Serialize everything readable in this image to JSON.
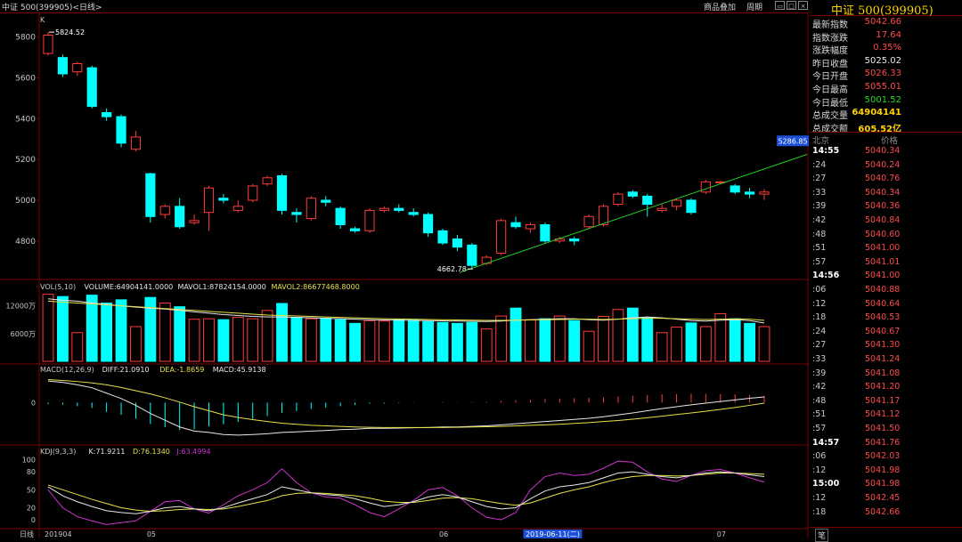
{
  "header": {
    "title": "中证 500(399905)<日线>",
    "btn_overlay": "商品叠加",
    "btn_period": "周期"
  },
  "quote": {
    "name": "中证  500(399905)",
    "rows": [
      {
        "label": "最新指数",
        "value": "5042.66",
        "color": "#ff4a4a"
      },
      {
        "label": "指数涨跌",
        "value": "17.64",
        "color": "#ff4a4a"
      },
      {
        "label": "涨跌幅度",
        "value": "0.35%",
        "color": "#ff4a4a"
      },
      {
        "label": "昨日收盘",
        "value": "5025.02",
        "color": "#e8e8e8"
      },
      {
        "label": "今日开盘",
        "value": "5026.33",
        "color": "#ff4a4a"
      },
      {
        "label": "今日最高",
        "value": "5055.01",
        "color": "#ff4a4a"
      },
      {
        "label": "今日最低",
        "value": "5001.52",
        "color": "#22dd22"
      },
      {
        "label": "总成交量",
        "value": "64904141",
        "color": "#ffd400"
      },
      {
        "label": "总成交额",
        "value": "605.52亿",
        "color": "#ffd400"
      }
    ],
    "tick_header": {
      "left": "北京",
      "right": "价格"
    },
    "ticks": [
      {
        "time": "14:55",
        "price": "5040.34",
        "bold": true
      },
      {
        "time": ":24",
        "price": "5040.24"
      },
      {
        "time": ":27",
        "price": "5040.76"
      },
      {
        "time": ":33",
        "price": "5040.34"
      },
      {
        "time": ":39",
        "price": "5040.36"
      },
      {
        "time": ":42",
        "price": "5040.84"
      },
      {
        "time": ":48",
        "price": "5040.60"
      },
      {
        "time": ":51",
        "price": "5041.00"
      },
      {
        "time": ":57",
        "price": "5041.01"
      },
      {
        "time": "14:56",
        "price": "5041.00",
        "bold": true
      },
      {
        "time": ":06",
        "price": "5040.88"
      },
      {
        "time": ":12",
        "price": "5040.64"
      },
      {
        "time": ":18",
        "price": "5040.53"
      },
      {
        "time": ":24",
        "price": "5040.67"
      },
      {
        "time": ":27",
        "price": "5041.30"
      },
      {
        "time": ":33",
        "price": "5041.24"
      },
      {
        "time": ":39",
        "price": "5041.08"
      },
      {
        "time": ":42",
        "price": "5041.20"
      },
      {
        "time": ":48",
        "price": "5041.17"
      },
      {
        "time": ":51",
        "price": "5041.12"
      },
      {
        "time": ":57",
        "price": "5041.50"
      },
      {
        "time": "14:57",
        "price": "5041.76",
        "bold": true
      },
      {
        "time": ":06",
        "price": "5042.03"
      },
      {
        "time": ":12",
        "price": "5041.98"
      },
      {
        "time": "15:00",
        "price": "5041.98",
        "bold": true
      },
      {
        "time": ":12",
        "price": "5042.45"
      },
      {
        "time": ":18",
        "price": "5042.66"
      }
    ],
    "tab_label": "笔"
  },
  "colors": {
    "up": "#ff3b3b",
    "down": "#00ffff",
    "grid": "#7a0000",
    "ma1": "#e8e8e8",
    "ma2": "#e8e04a",
    "macd_dea": "#e8e04a",
    "kdj_j": "#cc33cc"
  },
  "chart_data": [
    {
      "type": "candlestick",
      "title": "K",
      "ylim": [
        4620,
        5860
      ],
      "yticks": [
        4800,
        5000,
        5200,
        5400,
        5600,
        5800
      ],
      "current_price_label": "5286.85",
      "current_price_value": 5286.85,
      "annotation_high": {
        "text": "5824.52",
        "index": 0,
        "value": 5824.52
      },
      "annotation_low": {
        "text": "4662.78",
        "index": 29,
        "value": 4662.78
      },
      "trendline": {
        "from": [
          29,
          4662.78
        ],
        "to": [
          51,
          5110
        ]
      },
      "candles": [
        {
          "o": 5720,
          "c": 5810,
          "h": 5825,
          "l": 5710
        },
        {
          "o": 5700,
          "c": 5620,
          "h": 5715,
          "l": 5605
        },
        {
          "o": 5630,
          "c": 5670,
          "h": 5680,
          "l": 5610
        },
        {
          "o": 5650,
          "c": 5460,
          "h": 5660,
          "l": 5450
        },
        {
          "o": 5430,
          "c": 5410,
          "h": 5450,
          "l": 5390
        },
        {
          "o": 5410,
          "c": 5280,
          "h": 5420,
          "l": 5260
        },
        {
          "o": 5250,
          "c": 5310,
          "h": 5340,
          "l": 5240
        },
        {
          "o": 5130,
          "c": 4920,
          "h": 5135,
          "l": 4890
        },
        {
          "o": 4930,
          "c": 4970,
          "h": 4980,
          "l": 4910
        },
        {
          "o": 4970,
          "c": 4870,
          "h": 5010,
          "l": 4860
        },
        {
          "o": 4890,
          "c": 4900,
          "h": 4930,
          "l": 4880
        },
        {
          "o": 4940,
          "c": 5060,
          "h": 5070,
          "l": 4850
        },
        {
          "o": 5010,
          "c": 5000,
          "h": 5030,
          "l": 4985
        },
        {
          "o": 4950,
          "c": 4970,
          "h": 5000,
          "l": 4940
        },
        {
          "o": 5000,
          "c": 5070,
          "h": 5080,
          "l": 4990
        },
        {
          "o": 5080,
          "c": 5110,
          "h": 5120,
          "l": 5070
        },
        {
          "o": 5120,
          "c": 4950,
          "h": 5130,
          "l": 4930
        },
        {
          "o": 4940,
          "c": 4930,
          "h": 4960,
          "l": 4890
        },
        {
          "o": 4910,
          "c": 5010,
          "h": 5020,
          "l": 4900
        },
        {
          "o": 5000,
          "c": 4990,
          "h": 5020,
          "l": 4970
        },
        {
          "o": 4960,
          "c": 4880,
          "h": 4970,
          "l": 4860
        },
        {
          "o": 4860,
          "c": 4850,
          "h": 4870,
          "l": 4840
        },
        {
          "o": 4850,
          "c": 4950,
          "h": 4960,
          "l": 4840
        },
        {
          "o": 4950,
          "c": 4960,
          "h": 4970,
          "l": 4940
        },
        {
          "o": 4960,
          "c": 4950,
          "h": 4980,
          "l": 4940
        },
        {
          "o": 4940,
          "c": 4930,
          "h": 4960,
          "l": 4920
        },
        {
          "o": 4930,
          "c": 4840,
          "h": 4940,
          "l": 4820
        },
        {
          "o": 4850,
          "c": 4790,
          "h": 4860,
          "l": 4780
        },
        {
          "o": 4810,
          "c": 4770,
          "h": 4830,
          "l": 4750
        },
        {
          "o": 4780,
          "c": 4680,
          "h": 4790,
          "l": 4662.78
        },
        {
          "o": 4690,
          "c": 4720,
          "h": 4730,
          "l": 4680
        },
        {
          "o": 4740,
          "c": 4900,
          "h": 4910,
          "l": 4730
        },
        {
          "o": 4890,
          "c": 4870,
          "h": 4920,
          "l": 4860
        },
        {
          "o": 4860,
          "c": 4880,
          "h": 4890,
          "l": 4840
        },
        {
          "o": 4880,
          "c": 4800,
          "h": 4890,
          "l": 4790
        },
        {
          "o": 4800,
          "c": 4810,
          "h": 4820,
          "l": 4790
        },
        {
          "o": 4810,
          "c": 4800,
          "h": 4820,
          "l": 4780
        },
        {
          "o": 4870,
          "c": 4920,
          "h": 4930,
          "l": 4860
        },
        {
          "o": 4880,
          "c": 4970,
          "h": 4980,
          "l": 4870
        },
        {
          "o": 4980,
          "c": 5030,
          "h": 5040,
          "l": 4970
        },
        {
          "o": 5040,
          "c": 5020,
          "h": 5050,
          "l": 5010
        },
        {
          "o": 5020,
          "c": 4980,
          "h": 5030,
          "l": 4920
        },
        {
          "o": 4950,
          "c": 4960,
          "h": 4980,
          "l": 4940
        },
        {
          "o": 4970,
          "c": 5000,
          "h": 5010,
          "l": 4950
        },
        {
          "o": 5000,
          "c": 4940,
          "h": 5010,
          "l": 4930
        },
        {
          "o": 5040,
          "c": 5090,
          "h": 5100,
          "l": 5030
        },
        {
          "o": 5090,
          "c": 5090,
          "h": 5095,
          "l": 5080
        },
        {
          "o": 5070,
          "c": 5040,
          "h": 5080,
          "l": 5030
        },
        {
          "o": 5040,
          "c": 5030,
          "h": 5060,
          "l": 5010
        },
        {
          "o": 5030,
          "c": 5040,
          "h": 5055,
          "l": 5001.52
        }
      ]
    },
    {
      "type": "bar",
      "title": "VOL(5,10)",
      "legend": [
        {
          "text": "VOLUME:64904141.0000",
          "color": "#e8e8e8"
        },
        {
          "text": "MAVOL1:87824154.0000",
          "color": "#e8e8e8"
        },
        {
          "text": "MAVOL2:86677468.8000",
          "color": "#e8e04a"
        }
      ],
      "ylim": [
        0,
        15000
      ],
      "yticks": [
        {
          "value": 6000,
          "label": "6000万"
        },
        {
          "value": 12000,
          "label": "12000万"
        }
      ],
      "values": [
        14500,
        14000,
        6200,
        14300,
        12600,
        13300,
        7500,
        13800,
        12600,
        11800,
        9100,
        9200,
        9000,
        9500,
        9200,
        11000,
        12500,
        9500,
        9200,
        9300,
        9000,
        8200,
        8800,
        8700,
        9000,
        8900,
        8600,
        8400,
        8200,
        8400,
        7000,
        9800,
        11500,
        9000,
        9200,
        9800,
        8800,
        6500,
        9700,
        11200,
        11500,
        9500,
        6200,
        7400,
        8300,
        7500,
        10300,
        9200,
        8200,
        7500
      ],
      "mavol1": [
        13500,
        13200,
        13000,
        12600,
        12300,
        12000,
        11700,
        11500,
        11300,
        11000,
        10700,
        10400,
        10100,
        9900,
        9700,
        9600,
        9600,
        9500,
        9400,
        9300,
        9200,
        9100,
        9000,
        8950,
        8900,
        8850,
        8800,
        8750,
        8700,
        8650,
        8600,
        8700,
        8900,
        9000,
        9100,
        9200,
        9200,
        9000,
        8900,
        9100,
        9400,
        9600,
        9400,
        9100,
        8800,
        8700,
        8900,
        9000,
        8800,
        8300
      ],
      "mavol2": [
        13000,
        12800,
        12600,
        12400,
        12200,
        12000,
        11800,
        11600,
        11400,
        11200,
        11000,
        10800,
        10600,
        10400,
        10200,
        10000,
        9900,
        9800,
        9700,
        9600,
        9500,
        9400,
        9300,
        9200,
        9150,
        9100,
        9050,
        9000,
        8950,
        8900,
        8850,
        8850,
        8900,
        8950,
        9000,
        9050,
        9100,
        9100,
        9050,
        9100,
        9200,
        9300,
        9300,
        9200,
        9100,
        9050,
        9100,
        9150,
        9100,
        8850
      ]
    },
    {
      "type": "line",
      "title": "MACD(12,26,9)",
      "legend": [
        {
          "text": "DIFF:21.0910",
          "color": "#e8e8e8"
        },
        {
          "text": "DEA:-1.8659",
          "color": "#e8e04a"
        },
        {
          "text": "MACD:45.9138",
          "color": "#e8e8e8"
        }
      ],
      "ylim": [
        -150,
        100
      ],
      "yticks": [
        {
          "value": 0,
          "label": "0"
        }
      ],
      "diff": [
        80,
        75,
        66,
        55,
        35,
        15,
        -10,
        -40,
        -65,
        -90,
        -105,
        -110,
        -118,
        -120,
        -118,
        -115,
        -110,
        -108,
        -105,
        -103,
        -100,
        -98,
        -95,
        -95,
        -94,
        -93,
        -92,
        -90,
        -90,
        -88,
        -86,
        -82,
        -78,
        -74,
        -70,
        -66,
        -62,
        -58,
        -52,
        -45,
        -38,
        -30,
        -22,
        -15,
        -8,
        -2,
        4,
        10,
        16,
        21
      ],
      "dea": [
        85,
        82,
        78,
        73,
        66,
        56,
        44,
        32,
        18,
        2,
        -15,
        -30,
        -45,
        -55,
        -63,
        -70,
        -76,
        -80,
        -84,
        -86,
        -88,
        -90,
        -91,
        -92,
        -92,
        -92,
        -92,
        -92,
        -91,
        -90,
        -89,
        -88,
        -86,
        -84,
        -82,
        -80,
        -77,
        -74,
        -70,
        -66,
        -61,
        -56,
        -50,
        -44,
        -38,
        -32,
        -25,
        -18,
        -10,
        -2
      ],
      "macd": [
        -10,
        -14,
        -24,
        -36,
        -62,
        -82,
        -108,
        -144,
        -166,
        -184,
        -180,
        -160,
        -146,
        -130,
        -110,
        -90,
        -68,
        -56,
        -42,
        -34,
        -24,
        -16,
        -8,
        -6,
        -4,
        -2,
        0,
        4,
        2,
        4,
        6,
        12,
        16,
        20,
        24,
        28,
        30,
        32,
        36,
        42,
        46,
        52,
        56,
        58,
        60,
        60,
        58,
        56,
        52,
        46
      ]
    },
    {
      "type": "line",
      "title": "KDJ(9,3,3)",
      "legend": [
        {
          "text": "K:71.9211",
          "color": "#e8e8e8"
        },
        {
          "text": "D:76.1340",
          "color": "#e8e04a"
        },
        {
          "text": "J:63.4994",
          "color": "#cc33cc"
        }
      ],
      "ylim": [
        -12,
        110
      ],
      "yticks": [
        {
          "value": 0,
          "label": "0"
        },
        {
          "value": 20,
          "label": "20"
        },
        {
          "value": 50,
          "label": "50"
        },
        {
          "value": 80,
          "label": "80"
        },
        {
          "value": 100,
          "label": "100"
        }
      ],
      "k": [
        55,
        40,
        30,
        22,
        15,
        12,
        10,
        14,
        20,
        22,
        18,
        15,
        20,
        28,
        35,
        42,
        55,
        50,
        45,
        42,
        40,
        35,
        28,
        22,
        25,
        30,
        38,
        42,
        38,
        30,
        22,
        18,
        20,
        35,
        48,
        55,
        58,
        62,
        70,
        78,
        80,
        76,
        72,
        70,
        74,
        78,
        80,
        78,
        75,
        72
      ],
      "d": [
        58,
        50,
        42,
        34,
        27,
        20,
        16,
        14,
        15,
        17,
        18,
        17,
        18,
        22,
        27,
        32,
        40,
        44,
        45,
        44,
        42,
        40,
        36,
        31,
        29,
        29,
        32,
        36,
        37,
        35,
        31,
        27,
        24,
        28,
        36,
        44,
        50,
        55,
        62,
        68,
        72,
        74,
        74,
        73,
        74,
        76,
        78,
        78,
        77,
        76
      ],
      "j": [
        50,
        20,
        5,
        -2,
        -8,
        -5,
        -2,
        14,
        30,
        32,
        18,
        11,
        25,
        40,
        50,
        62,
        85,
        62,
        45,
        38,
        36,
        25,
        12,
        5,
        18,
        32,
        50,
        54,
        40,
        20,
        4,
        0,
        12,
        50,
        72,
        78,
        74,
        76,
        86,
        98,
        96,
        80,
        68,
        64,
        74,
        82,
        84,
        78,
        70,
        63
      ]
    }
  ],
  "xaxis": {
    "labels": [
      {
        "text": "201904",
        "index": 0
      },
      {
        "text": "05",
        "index": 7
      },
      {
        "text": "06",
        "index": 27
      },
      {
        "text": "2019-06-11(二)",
        "index": 33,
        "highlight": true
      },
      {
        "text": "07",
        "index": 46
      }
    ],
    "corner_label": "日线"
  }
}
